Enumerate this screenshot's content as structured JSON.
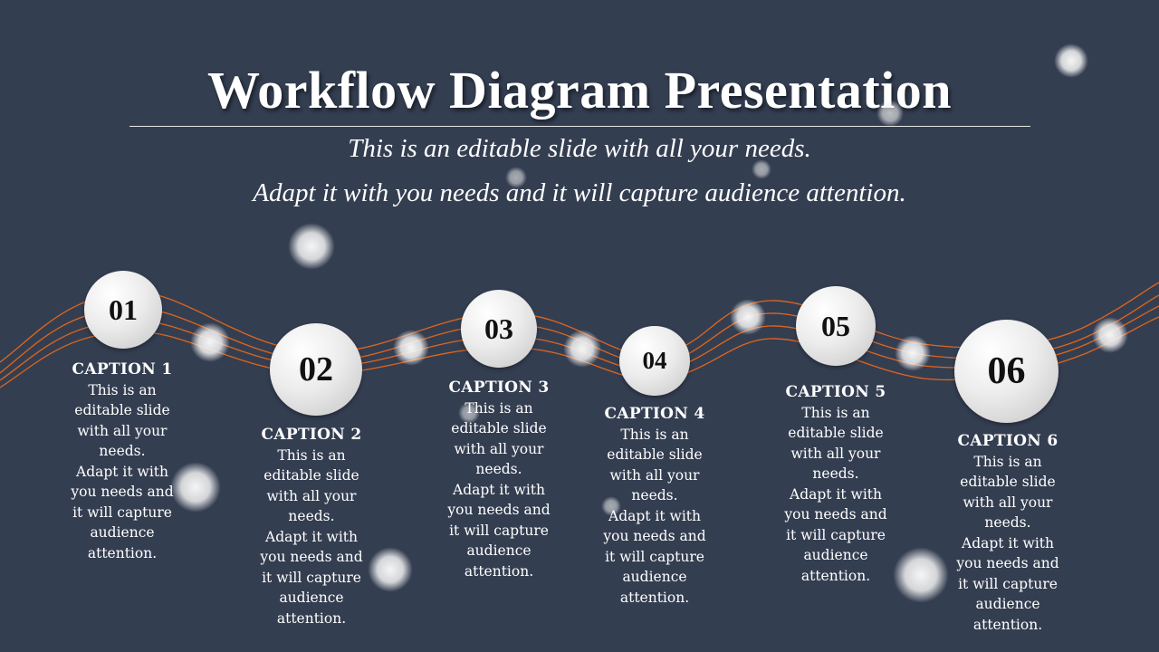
{
  "slide": {
    "title": "Workflow Diagram Presentation",
    "subtitle_line1": "This is an editable slide with all your needs.",
    "subtitle_line2": "Adapt it with you needs and it will capture audience attention."
  },
  "colors": {
    "background": "#343e51",
    "wave": "#e0651c",
    "text": "#ffffff",
    "node": "#ececec"
  },
  "steps": [
    {
      "number": "01",
      "caption": "CAPTION 1",
      "body": "This is an\neditable slide\nwith all your\nneeds.\nAdapt it with\nyou needs and\nit will capture\naudience\nattention."
    },
    {
      "number": "02",
      "caption": "CAPTION 2",
      "body": "This is an\neditable slide\nwith all your\nneeds.\nAdapt it with\nyou needs and\nit will capture\naudience\nattention."
    },
    {
      "number": "03",
      "caption": "CAPTION 3",
      "body": "This is an\neditable slide\nwith all your\nneeds.\nAdapt it with\nyou needs and\nit will capture\naudience\nattention."
    },
    {
      "number": "04",
      "caption": "CAPTION 4",
      "body": "This is an\neditable slide\nwith all your\nneeds.\nAdapt it with\nyou needs and\nit will capture\naudience\nattention."
    },
    {
      "number": "05",
      "caption": "CAPTION 5",
      "body": "This is an\neditable slide\nwith all your\nneeds.\nAdapt it with\nyou needs and\nit will capture\naudience\nattention."
    },
    {
      "number": "06",
      "caption": "CAPTION 6",
      "body": "This is an\neditable slide\nwith all your\nneeds.\nAdapt it with\nyou needs and\nit will capture\naudience\nattention."
    }
  ]
}
